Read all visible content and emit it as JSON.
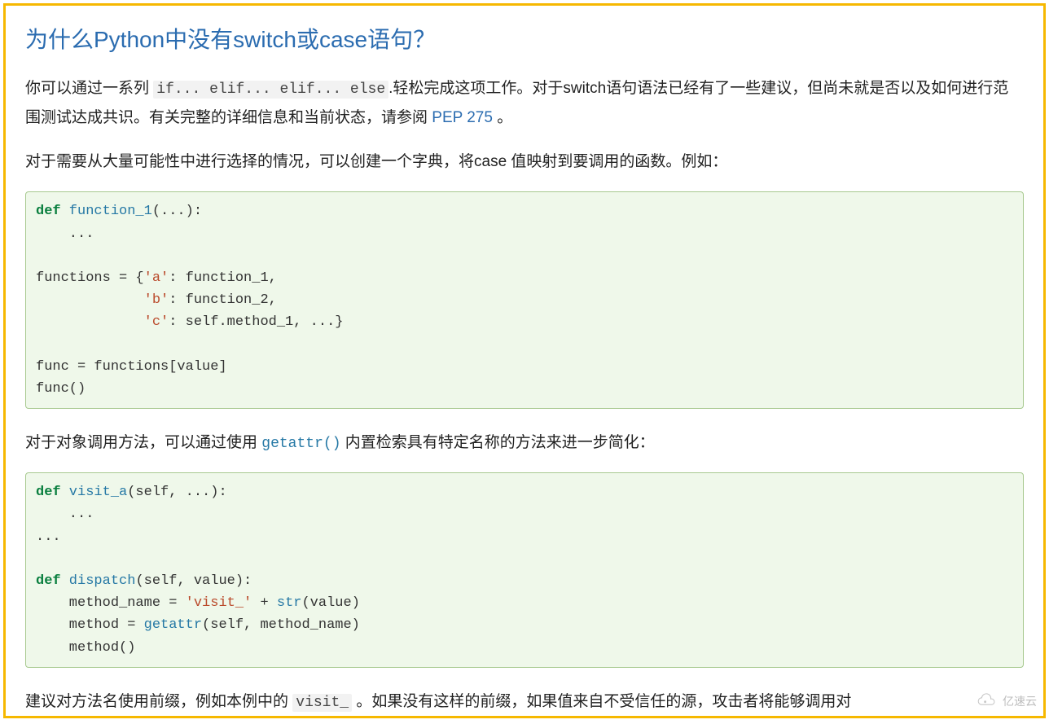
{
  "title": "为什么Python中没有switch或case语句？",
  "para1_a": "你可以通过一系列 ",
  "para1_code": "if... elif... elif... else",
  "para1_b": ".轻松完成这项工作。对于switch语句语法已经有了一些建议，但尚未就是否以及如何进行范围测试达成共识。有关完整的详细信息和当前状态，请参阅 ",
  "para1_link": "PEP 275",
  "para1_c": " 。",
  "para2": "对于需要从大量可能性中进行选择的情况，可以创建一个字典，将case 值映射到要调用的函数。例如：",
  "code1": {
    "l1_def": "def",
    "l1_fn": " function_1",
    "l1_rest": "(...):",
    "l2": "    ...",
    "l3": "",
    "l4_a": "functions = {",
    "l4_s": "'a'",
    "l4_b": ": function_1,",
    "l5_a": "             ",
    "l5_s": "'b'",
    "l5_b": ": function_2,",
    "l6_a": "             ",
    "l6_s": "'c'",
    "l6_b": ": self.method_1, ...}",
    "l7": "",
    "l8": "func = functions[value]",
    "l9": "func()"
  },
  "para3_a": "对于对象调用方法，可以通过使用 ",
  "para3_code": "getattr()",
  "para3_b": " 内置检索具有特定名称的方法来进一步简化：",
  "code2": {
    "l1_def": "def",
    "l1_fn": " visit_a",
    "l1_rest": "(self, ...):",
    "l2": "    ...",
    "l3": "...",
    "l4": "",
    "l5_def": "def",
    "l5_fn": " dispatch",
    "l5_rest": "(self, value):",
    "l6_a": "    method_name = ",
    "l6_s": "'visit_'",
    "l6_b": " + ",
    "l6_fn": "str",
    "l6_c": "(value)",
    "l7_a": "    method = ",
    "l7_fn": "getattr",
    "l7_b": "(self, method_name)",
    "l8": "    method()"
  },
  "para4_a": "建议对方法名使用前缀，例如本例中的 ",
  "para4_code": "visit_",
  "para4_b": " 。如果没有这样的前缀，如果值来自不受信任的源，攻击者将能够调用对",
  "watermark": "亿速云"
}
